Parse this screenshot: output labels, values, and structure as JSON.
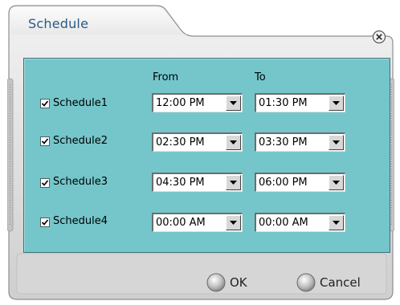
{
  "dialog": {
    "title": "Schedule"
  },
  "columns": {
    "from": "From",
    "to": "To"
  },
  "rows": [
    {
      "label": "Schedule1",
      "checked": true,
      "from": "12:00 PM",
      "to": "01:30 PM"
    },
    {
      "label": "Schedule2",
      "checked": true,
      "from": "02:30 PM",
      "to": "03:30 PM"
    },
    {
      "label": "Schedule3",
      "checked": true,
      "from": "04:30 PM",
      "to": "06:00 PM"
    },
    {
      "label": "Schedule4",
      "checked": true,
      "from": "00:00 AM",
      "to": "00:00 AM"
    }
  ],
  "buttons": {
    "ok": "OK",
    "cancel": "Cancel"
  },
  "colors": {
    "panel": "#74c6cb",
    "frame": "#d3d3d3",
    "title": "#2c5a86"
  },
  "icons": {
    "close": "close-circle-icon",
    "dropdown": "dropdown-arrow-icon",
    "button": "round-button-icon"
  }
}
